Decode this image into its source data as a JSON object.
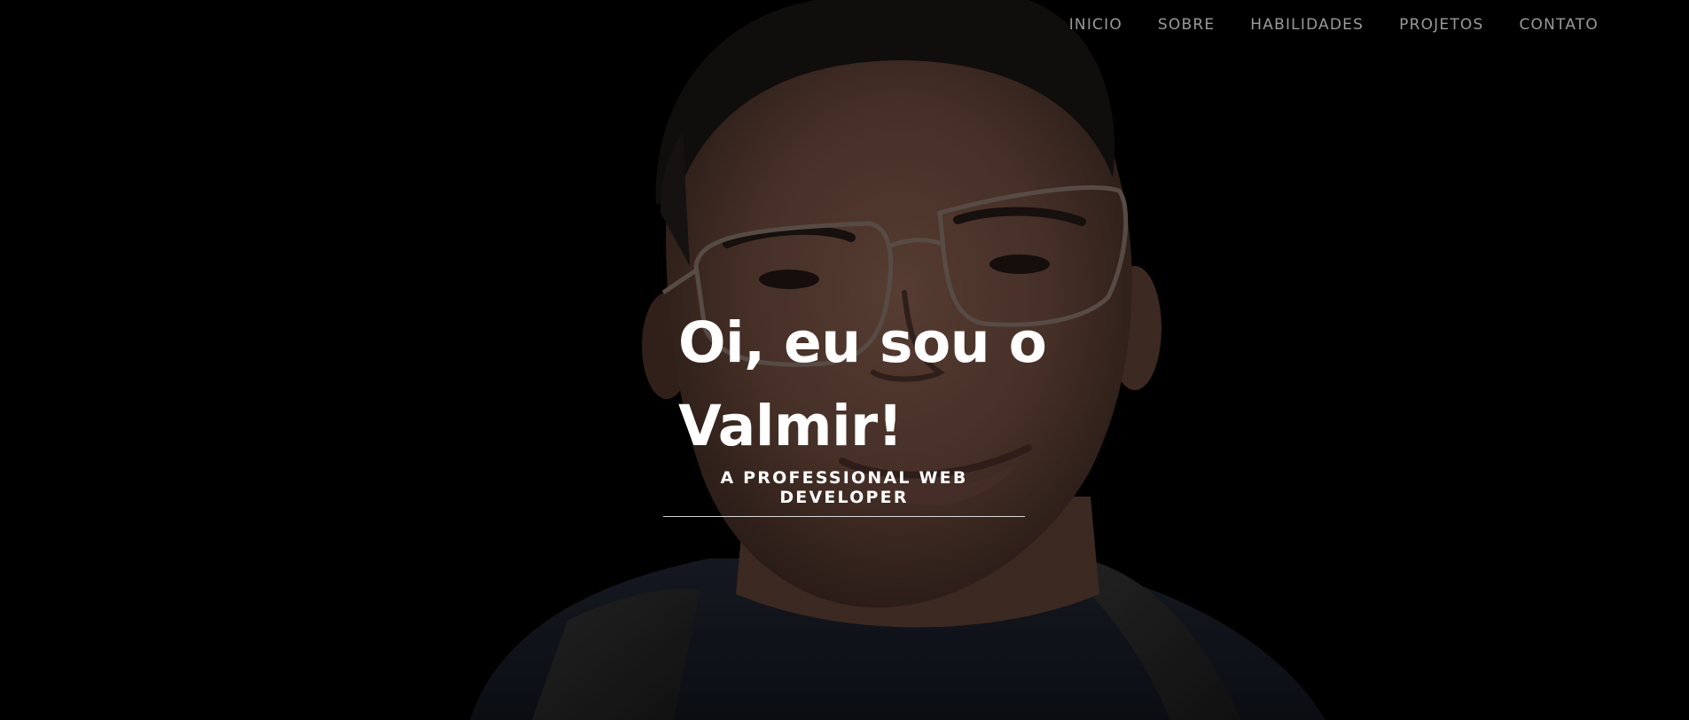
{
  "nav": {
    "items": [
      {
        "label": "INICIO"
      },
      {
        "label": "SOBRE"
      },
      {
        "label": "HABILIDADES"
      },
      {
        "label": "PROJETOS"
      },
      {
        "label": "CONTATO"
      }
    ]
  },
  "hero": {
    "title_line1": "Oi, eu sou o",
    "title_line2": "Valmir!",
    "subtitle": "A PROFESSIONAL WEB DEVELOPER"
  },
  "colors": {
    "background": "#000000",
    "nav_text": "#9a9a9a",
    "title_text": "#ffffff",
    "divider": "#d8d8d8"
  }
}
